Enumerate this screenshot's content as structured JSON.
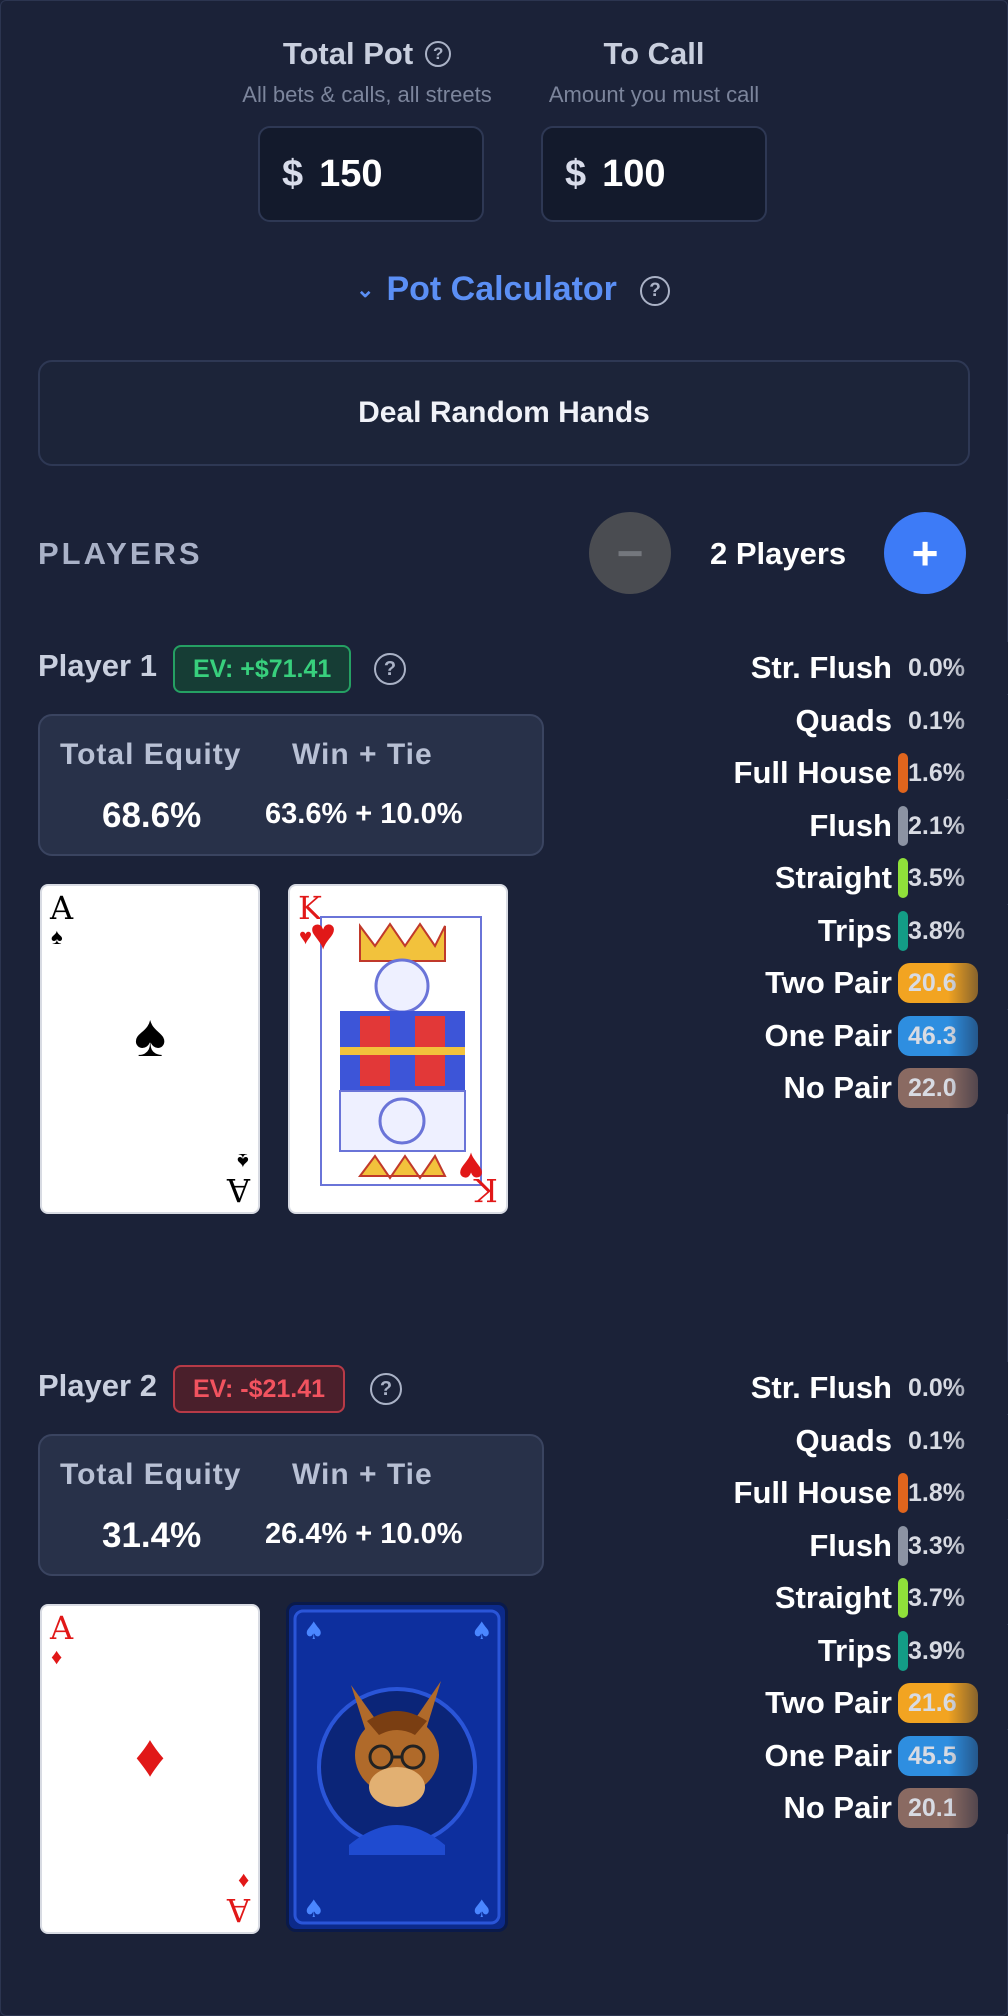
{
  "pot": {
    "total": {
      "title": "Total Pot",
      "subtitle": "All bets & calls, all streets",
      "currency": "$",
      "value": "150"
    },
    "call": {
      "title": "To Call",
      "subtitle": "Amount you must call",
      "currency": "$",
      "value": "100"
    },
    "calculator_label": "Pot Calculator"
  },
  "deal_button": "Deal Random Hands",
  "players_section": {
    "label": "PLAYERS",
    "count_label": "2 Players",
    "minus": "−",
    "plus": "+"
  },
  "equity_labels": {
    "total": "Total Equity",
    "split": "Win + Tie"
  },
  "players": [
    {
      "name": "Player 1",
      "ev": "EV: +$71.41",
      "total_equity": "68.6%",
      "win_tie": "63.6% + 10.0%",
      "cards": [
        {
          "rank": "A",
          "suit": "♠",
          "color": "black"
        },
        {
          "rank": "K",
          "suit": "♥",
          "color": "red",
          "face": "king"
        }
      ],
      "hand_stats": [
        {
          "name": "Str. Flush",
          "value": "0.0%"
        },
        {
          "name": "Quads",
          "value": "0.1%"
        },
        {
          "name": "Full House",
          "value": "1.6%"
        },
        {
          "name": "Flush",
          "value": "2.1%"
        },
        {
          "name": "Straight",
          "value": "3.5%"
        },
        {
          "name": "Trips",
          "value": "3.8%"
        },
        {
          "name": "Two Pair",
          "value": "20.6"
        },
        {
          "name": "One Pair",
          "value": "46.3"
        },
        {
          "name": "No Pair",
          "value": "22.0"
        }
      ]
    },
    {
      "name": "Player 2",
      "ev": "EV: -$21.41",
      "total_equity": "31.4%",
      "win_tie": "26.4% + 10.0%",
      "cards": [
        {
          "rank": "A",
          "suit": "♦",
          "color": "red"
        },
        {
          "back": true
        }
      ],
      "hand_stats": [
        {
          "name": "Str. Flush",
          "value": "0.0%"
        },
        {
          "name": "Quads",
          "value": "0.1%"
        },
        {
          "name": "Full House",
          "value": "1.8%"
        },
        {
          "name": "Flush",
          "value": "3.3%"
        },
        {
          "name": "Straight",
          "value": "3.7%"
        },
        {
          "name": "Trips",
          "value": "3.9%"
        },
        {
          "name": "Two Pair",
          "value": "21.6"
        },
        {
          "name": "One Pair",
          "value": "45.5"
        },
        {
          "name": "No Pair",
          "value": "20.1"
        }
      ]
    }
  ],
  "stat_colors": [
    "#1b2238",
    "#1b2238",
    "#e0651d",
    "#8c93a3",
    "#8fe03a",
    "#139d86",
    "#f2a421",
    "#2e8ee0",
    "#8a6a62"
  ],
  "icons": {
    "help": "help-circle-icon",
    "chevron": "chevron-down-icon",
    "minus": "minus-icon",
    "plus": "plus-icon"
  }
}
